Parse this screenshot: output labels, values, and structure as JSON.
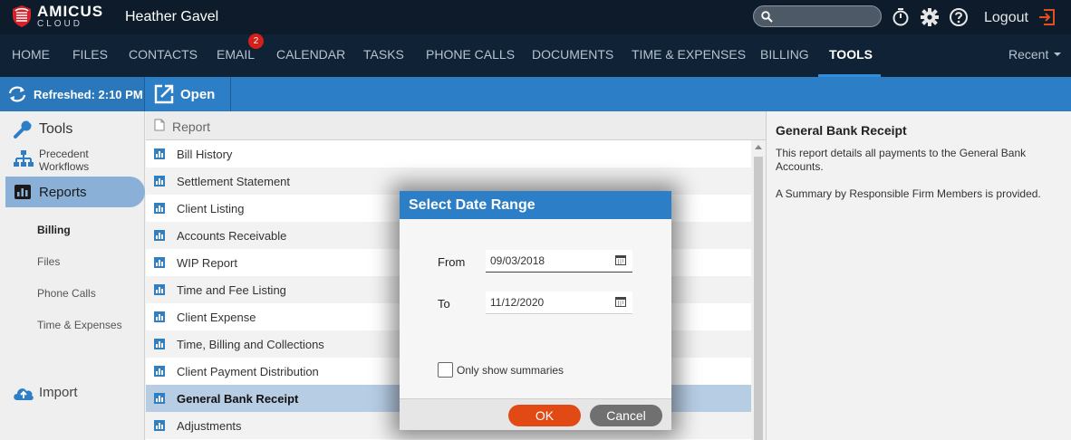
{
  "app": {
    "logo_main": "AMICUS",
    "logo_sub": "CLOUD",
    "user_name": "Heather Gavel",
    "logout_label": "Logout"
  },
  "colors": {
    "topbar": "#0e1b2b",
    "navbar": "#0f2236",
    "accent": "#2c7fc6",
    "ok_button": "#e24a15",
    "cancel_button": "#707070",
    "badge": "#d4201a",
    "selected_row": "#b7cde4"
  },
  "nav": {
    "items": [
      "HOME",
      "FILES",
      "CONTACTS",
      "EMAIL",
      "CALENDAR",
      "TASKS",
      "PHONE CALLS",
      "DOCUMENTS",
      "TIME & EXPENSES",
      "BILLING",
      "TOOLS"
    ],
    "active": "TOOLS",
    "email_badge": "2",
    "recent_label": "Recent"
  },
  "toolbar": {
    "refreshed_label": "Refreshed: 2:10 PM",
    "open_label": "Open"
  },
  "sidebar": {
    "tools_label": "Tools",
    "precedent_label": "Precedent Workflows",
    "reports_label": "Reports",
    "sub_items": [
      "Billing",
      "Files",
      "Phone Calls",
      "Time & Expenses"
    ],
    "active_sub": "Billing",
    "import_label": "Import"
  },
  "report_list": {
    "header": "Report",
    "rows": [
      "Bill History",
      "Settlement Statement",
      "Client Listing",
      "Accounts Receivable",
      "WIP Report",
      "Time and Fee Listing",
      "Client Expense",
      "Time, Billing and Collections",
      "Client Payment Distribution",
      "General Bank Receipt",
      "Adjustments"
    ],
    "selected": "General Bank Receipt"
  },
  "detail": {
    "title": "General Bank Receipt",
    "description": "This report details all payments to the General Bank Accounts.",
    "summary_note": "A Summary by Responsible Firm Members is provided."
  },
  "dialog": {
    "title": "Select Date Range",
    "from_label": "From",
    "from_value": "09/03/2018",
    "to_label": "To",
    "to_value": "11/12/2020",
    "summaries_label": "Only show summaries",
    "summaries_checked": false,
    "ok_label": "OK",
    "cancel_label": "Cancel"
  },
  "icons": [
    "amicus-shield-logo",
    "search-icon",
    "stopwatch-icon",
    "gear-icon",
    "help-icon",
    "logout-icon",
    "refresh-icon",
    "open-external-icon",
    "wrench-icon",
    "org-chart-icon",
    "bar-chart-icon",
    "document-icon",
    "report-icon",
    "calendar-icon",
    "cloud-upload-icon"
  ]
}
